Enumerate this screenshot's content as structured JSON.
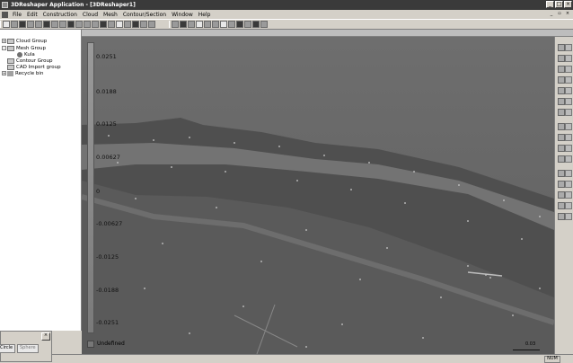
{
  "window": {
    "title": "3DReshaper Application - [3DReshaper1]"
  },
  "menu": [
    "File",
    "Edit",
    "Construction",
    "Cloud",
    "Mesh",
    "Contour/Section",
    "Window",
    "Help"
  ],
  "tree": [
    {
      "label": "Cloud Group",
      "level": 0
    },
    {
      "label": "Mesh Group",
      "level": 0
    },
    {
      "label": "Kula",
      "level": 1
    },
    {
      "label": "Contour Group",
      "level": 0
    },
    {
      "label": "CAD Import group",
      "level": 0
    },
    {
      "label": "Recycle bin",
      "level": 0
    }
  ],
  "scale": {
    "labels": [
      "0.0251",
      "0.0188",
      "0.0125",
      "0.00627",
      "0",
      "-0.00627",
      "-0.0125",
      "-0.0188",
      "-0.0251"
    ],
    "undefined_label": "Undefined",
    "scale_bar_label": "0.03"
  },
  "bottom_panel": {
    "tabs": [
      "Circle",
      "Sphere"
    ],
    "close": "×"
  },
  "status": {
    "num": "NUM"
  }
}
